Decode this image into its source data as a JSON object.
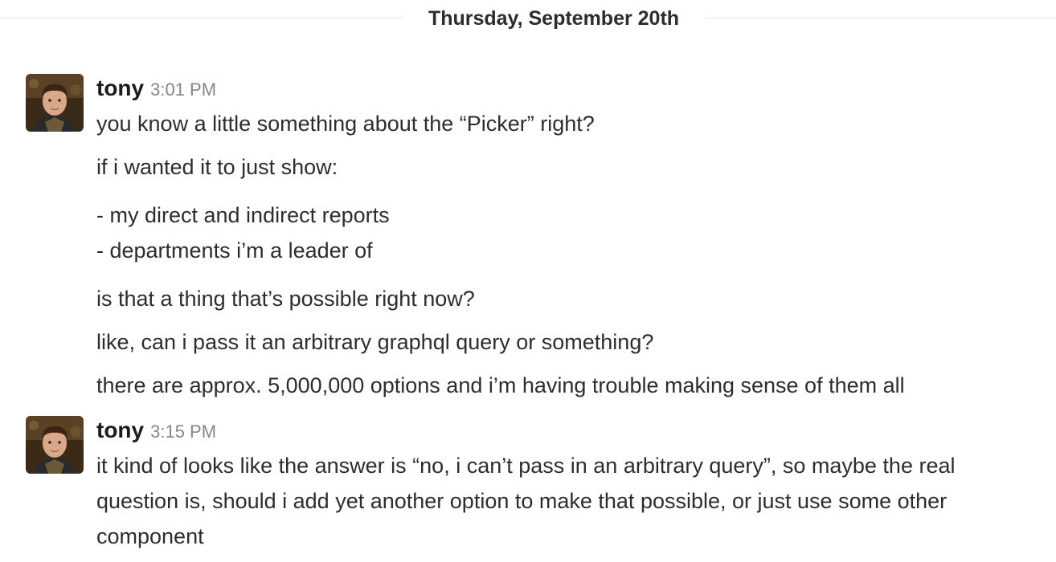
{
  "day_divider": {
    "label": "Thursday, September 20th"
  },
  "messages": [
    {
      "author": "tony",
      "time": "3:01 PM",
      "lines": [
        "you know a little something about the “Picker” right?",
        "if i wanted it to just show:",
        "- my direct and indirect reports",
        "- departments i’m a leader of",
        "is that a thing that’s possible right now?",
        "like, can i pass it an arbitrary graphql query or something?",
        "there are approx. 5,000,000 options and i’m having trouble making sense of them all"
      ]
    },
    {
      "author": "tony",
      "time": "3:15 PM",
      "lines": [
        "it kind of looks like the answer is “no, i can’t pass in an arbitrary query”, so maybe the real",
        "question is, should i add yet another option to make that possible, or just use some other",
        "component"
      ]
    }
  ]
}
